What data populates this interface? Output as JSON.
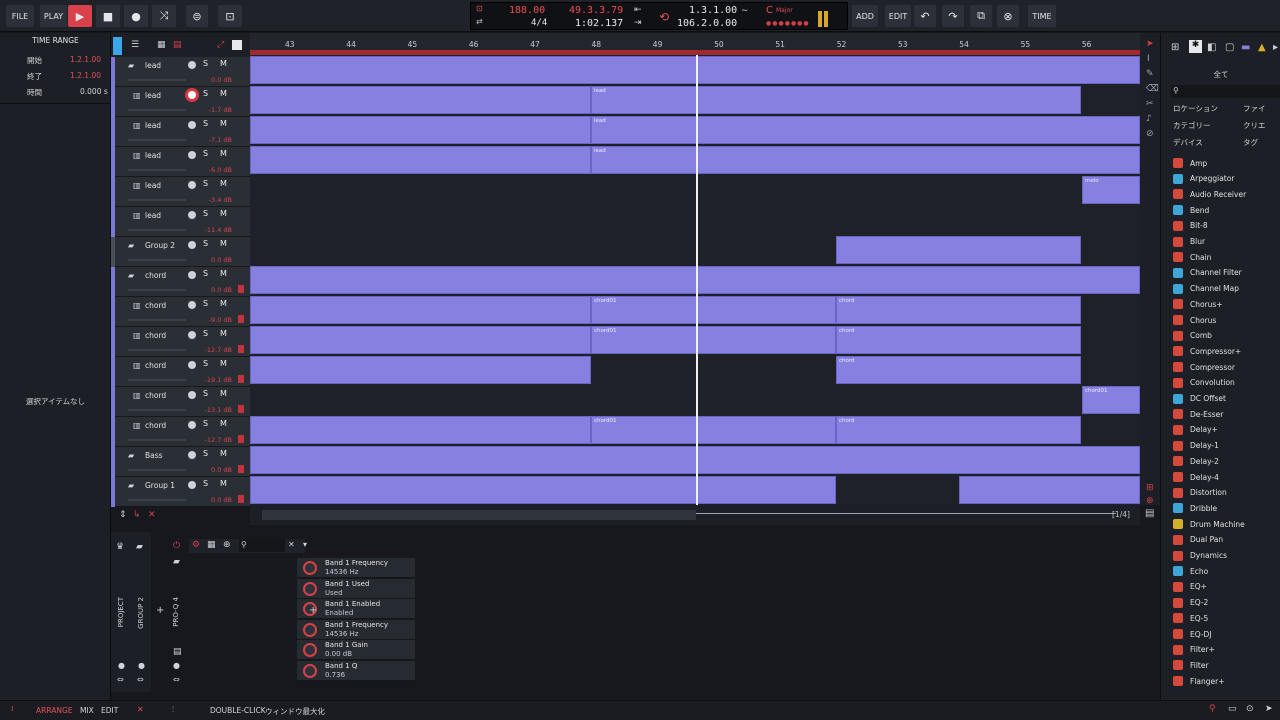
{
  "transport": {
    "file": "FILE",
    "play": "PLAY",
    "add": "ADD",
    "edit": "EDIT",
    "time": "TIME",
    "tempo": "188.00",
    "signature": "4/4",
    "position_beats": "49.3.3.79",
    "position_time": "1:02.137",
    "loop_start": "1.3.1.00",
    "loop_end": "106.2.0.00",
    "key_note": "C",
    "key_mode": "Major"
  },
  "time_range": {
    "title": "TIME RANGE",
    "start_label": "開始",
    "start_value": "1.2.1.00",
    "end_label": "終了",
    "end_value": "1.2.1.00",
    "duration_label": "時間",
    "duration_value": "0.000 s",
    "no_selection": "選択アイテムなし"
  },
  "ruler": {
    "bars": [
      "43",
      "44",
      "45",
      "46",
      "47",
      "48",
      "49",
      "50",
      "51",
      "52",
      "53",
      "54",
      "55",
      "56"
    ]
  },
  "tracks": [
    {
      "name": "lead",
      "type": "folder",
      "db": "0.0 dB",
      "rec": false
    },
    {
      "name": "lead",
      "type": "inst",
      "db": "-1.7 dB",
      "rec": true
    },
    {
      "name": "lead",
      "type": "inst",
      "db": "-7.1 dB",
      "rec": false
    },
    {
      "name": "lead",
      "type": "inst",
      "db": "-6.0 dB",
      "rec": false
    },
    {
      "name": "lead",
      "type": "inst",
      "db": "-3.4 dB",
      "rec": false
    },
    {
      "name": "lead",
      "type": "inst",
      "db": "-11.4 dB",
      "rec": false
    },
    {
      "name": "Group 2",
      "type": "folder",
      "db": "0.0 dB",
      "rec": false
    },
    {
      "name": "chord",
      "type": "folder",
      "db": "0.0 dB",
      "rec": false
    },
    {
      "name": "chord",
      "type": "inst",
      "db": "-9.0 dB",
      "rec": false
    },
    {
      "name": "chord",
      "type": "inst",
      "db": "-12.7 dB",
      "rec": false
    },
    {
      "name": "chord",
      "type": "inst",
      "db": "-19.1 dB",
      "rec": false
    },
    {
      "name": "chord",
      "type": "inst",
      "db": "-13.1 dB",
      "rec": false
    },
    {
      "name": "chord",
      "type": "inst",
      "db": "-12.7 dB",
      "rec": false
    },
    {
      "name": "Bass",
      "type": "folder",
      "db": "0.0 dB",
      "rec": false
    },
    {
      "name": "Group 1",
      "type": "folder",
      "db": "0.0 dB",
      "rec": false
    }
  ],
  "track_buttons": {
    "solo": "S",
    "mute": "M"
  },
  "clip_labels": {
    "lead": "lead",
    "melody": "melo",
    "chord01": "chord01",
    "chord": "chord"
  },
  "page_indicator": "[1/4]",
  "device_panel": {
    "tabs": [
      "PROJECT",
      "GROUP 2",
      "PRO-Q 4"
    ],
    "params": [
      {
        "name": "Band 1 Frequency",
        "value": "14536 Hz"
      },
      {
        "name": "Band 1 Used",
        "value": "Used"
      },
      {
        "name": "Band 1 Enabled",
        "value": "Enabled"
      },
      {
        "name": "Band 1 Frequency",
        "value": "14536 Hz"
      },
      {
        "name": "Band 1 Gain",
        "value": "0.00 dB"
      },
      {
        "name": "Band 1 Q",
        "value": "0.736"
      }
    ]
  },
  "browser": {
    "all": "全て",
    "filters": [
      "ロケーション",
      "ファイ",
      "カテゴリー",
      "クリエ",
      "デバイス",
      "タグ"
    ],
    "plugins": [
      {
        "name": "Amp",
        "c": "r"
      },
      {
        "name": "Arpeggiator",
        "c": "b"
      },
      {
        "name": "Audio Receiver",
        "c": "r"
      },
      {
        "name": "Bend",
        "c": "b"
      },
      {
        "name": "Bit-8",
        "c": "r"
      },
      {
        "name": "Blur",
        "c": "r"
      },
      {
        "name": "Chain",
        "c": "r"
      },
      {
        "name": "Channel Filter",
        "c": "b"
      },
      {
        "name": "Channel Map",
        "c": "b"
      },
      {
        "name": "Chorus+",
        "c": "r"
      },
      {
        "name": "Chorus",
        "c": "r"
      },
      {
        "name": "Comb",
        "c": "r"
      },
      {
        "name": "Compressor+",
        "c": "r"
      },
      {
        "name": "Compressor",
        "c": "r"
      },
      {
        "name": "Convolution",
        "c": "r"
      },
      {
        "name": "DC Offset",
        "c": "b"
      },
      {
        "name": "De-Esser",
        "c": "r"
      },
      {
        "name": "Delay+",
        "c": "r"
      },
      {
        "name": "Delay-1",
        "c": "r"
      },
      {
        "name": "Delay-2",
        "c": "r"
      },
      {
        "name": "Delay-4",
        "c": "r"
      },
      {
        "name": "Distortion",
        "c": "r"
      },
      {
        "name": "Dribble",
        "c": "b"
      },
      {
        "name": "Drum Machine",
        "c": "y"
      },
      {
        "name": "Dual Pan",
        "c": "r"
      },
      {
        "name": "Dynamics",
        "c": "r"
      },
      {
        "name": "Echo",
        "c": "b"
      },
      {
        "name": "EQ+",
        "c": "r"
      },
      {
        "name": "EQ-2",
        "c": "r"
      },
      {
        "name": "EQ-5",
        "c": "r"
      },
      {
        "name": "EQ-DJ",
        "c": "r"
      },
      {
        "name": "Filter+",
        "c": "r"
      },
      {
        "name": "Filter",
        "c": "r"
      },
      {
        "name": "Flanger+",
        "c": "r"
      }
    ]
  },
  "status": {
    "arrange": "ARRANGE",
    "mix": "MIX",
    "edit": "EDIT",
    "double_click": "DOUBLE-CLICK",
    "hint": "ウィンドウ最大化"
  }
}
